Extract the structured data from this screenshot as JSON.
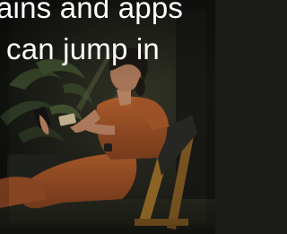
{
  "hero": {
    "headline_line1": "ains and apps",
    "headline_line2": "can jump in"
  },
  "colors": {
    "text": "#ffffff",
    "dress": "#b35a2c",
    "foliage": "#3a4a2e",
    "chair": "#a8772c",
    "background": "#1a1a17"
  }
}
